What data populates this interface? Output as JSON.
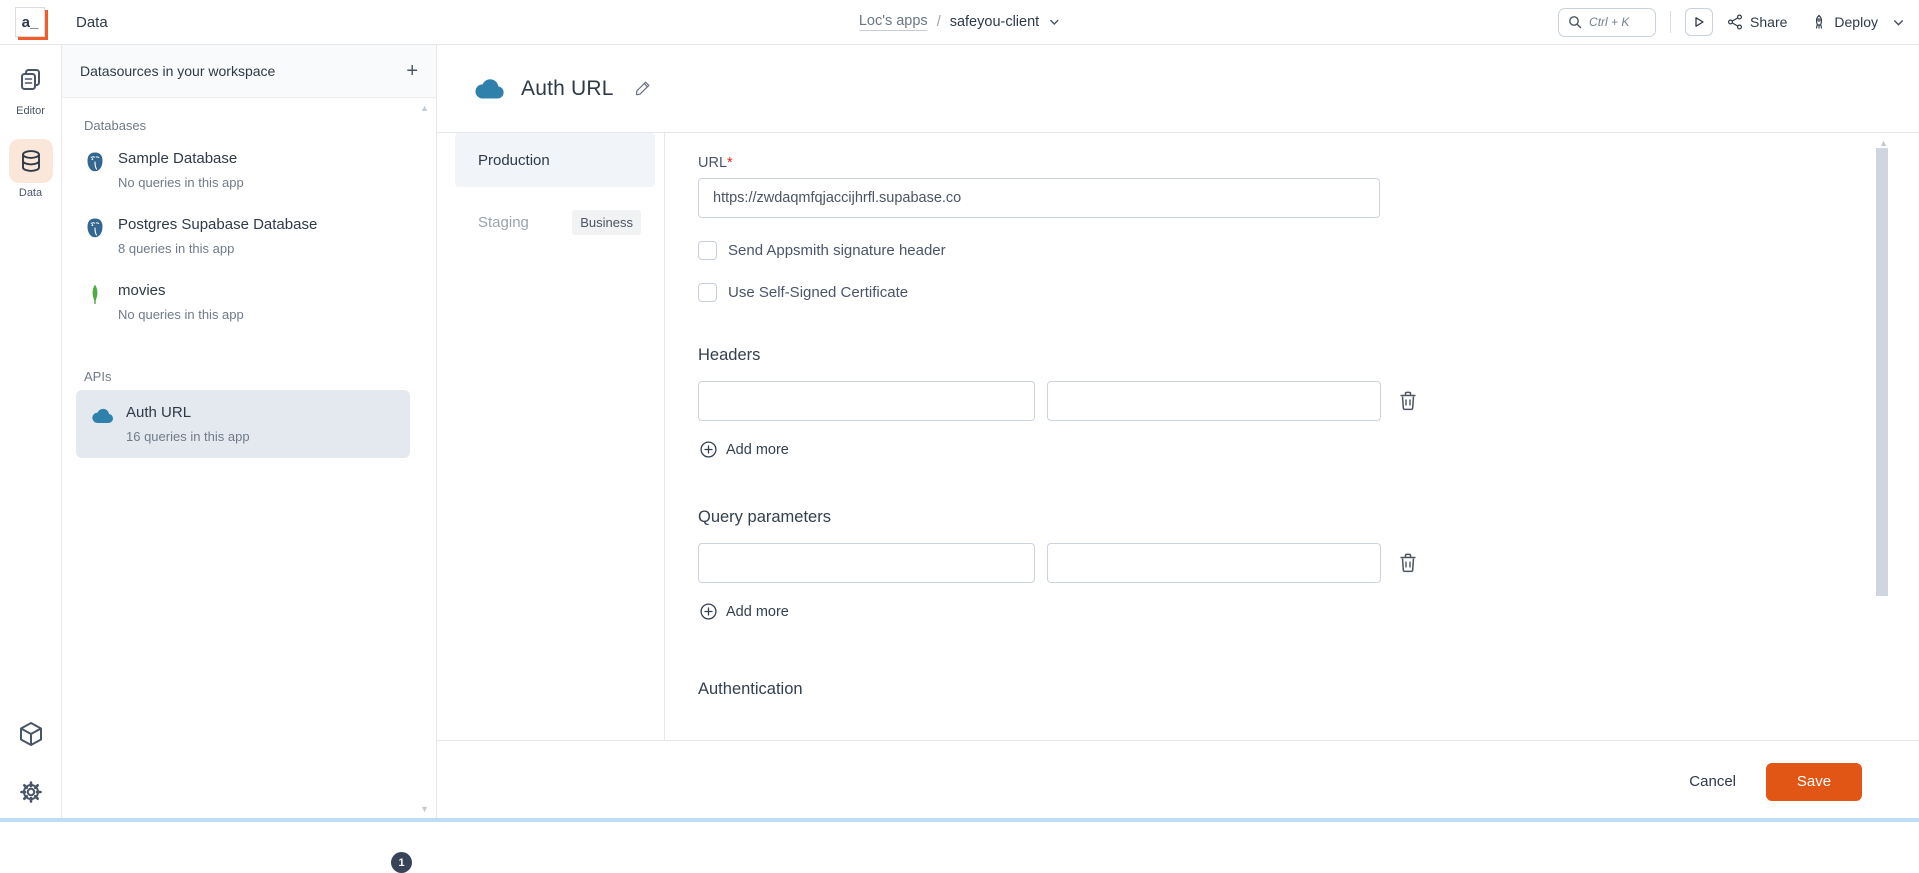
{
  "topbar": {
    "app_title": "Data",
    "breadcrumb": {
      "workspace": "Loc's apps",
      "separator": "/",
      "app": "safeyou-client"
    },
    "search_shortcut": "Ctrl + K",
    "share_label": "Share",
    "deploy_label": "Deploy"
  },
  "rail": {
    "editor_label": "Editor",
    "data_label": "Data"
  },
  "sidebar": {
    "header": "Datasources in your workspace",
    "add_button": "+",
    "sections": [
      {
        "title": "Databases",
        "items": [
          {
            "name": "Sample Database",
            "sub": "No queries in this app",
            "icon": "postgres-icon"
          },
          {
            "name": "Postgres Supabase Database",
            "sub": "8 queries in this app",
            "icon": "postgres-icon"
          },
          {
            "name": "movies",
            "sub": "No queries in this app",
            "icon": "mongodb-icon"
          }
        ]
      },
      {
        "title": "APIs",
        "items": [
          {
            "name": "Auth URL",
            "sub": "16 queries in this app",
            "icon": "cloud-icon",
            "selected": true
          }
        ]
      }
    ],
    "notification_badge": "1"
  },
  "main": {
    "title": "Auth URL",
    "env_tabs": [
      {
        "label": "Production",
        "active": true
      },
      {
        "label": "Staging",
        "badge": "Business"
      }
    ],
    "form": {
      "url_label": "URL",
      "required_mark": "*",
      "url_value": "https://zwdaqmfqjaccijhrfl.supabase.co",
      "checkbox_signature": "Send Appsmith signature header",
      "checkbox_certificate": "Use Self-Signed Certificate",
      "headers_title": "Headers",
      "query_params_title": "Query parameters",
      "add_more_label": "Add more",
      "authentication_title": "Authentication"
    },
    "footer": {
      "cancel_label": "Cancel",
      "save_label": "Save"
    }
  },
  "colors": {
    "brand_orange": "#F35c25",
    "save_button": "#E15615",
    "cloud_blue": "#3080AC",
    "postgres_blue": "#336791",
    "mongodb_green": "#4FAA41",
    "active_rail_bg": "#FBE7D9",
    "selected_row_bg": "#E4E9EF",
    "active_tab_bg": "#F1F4F8"
  }
}
